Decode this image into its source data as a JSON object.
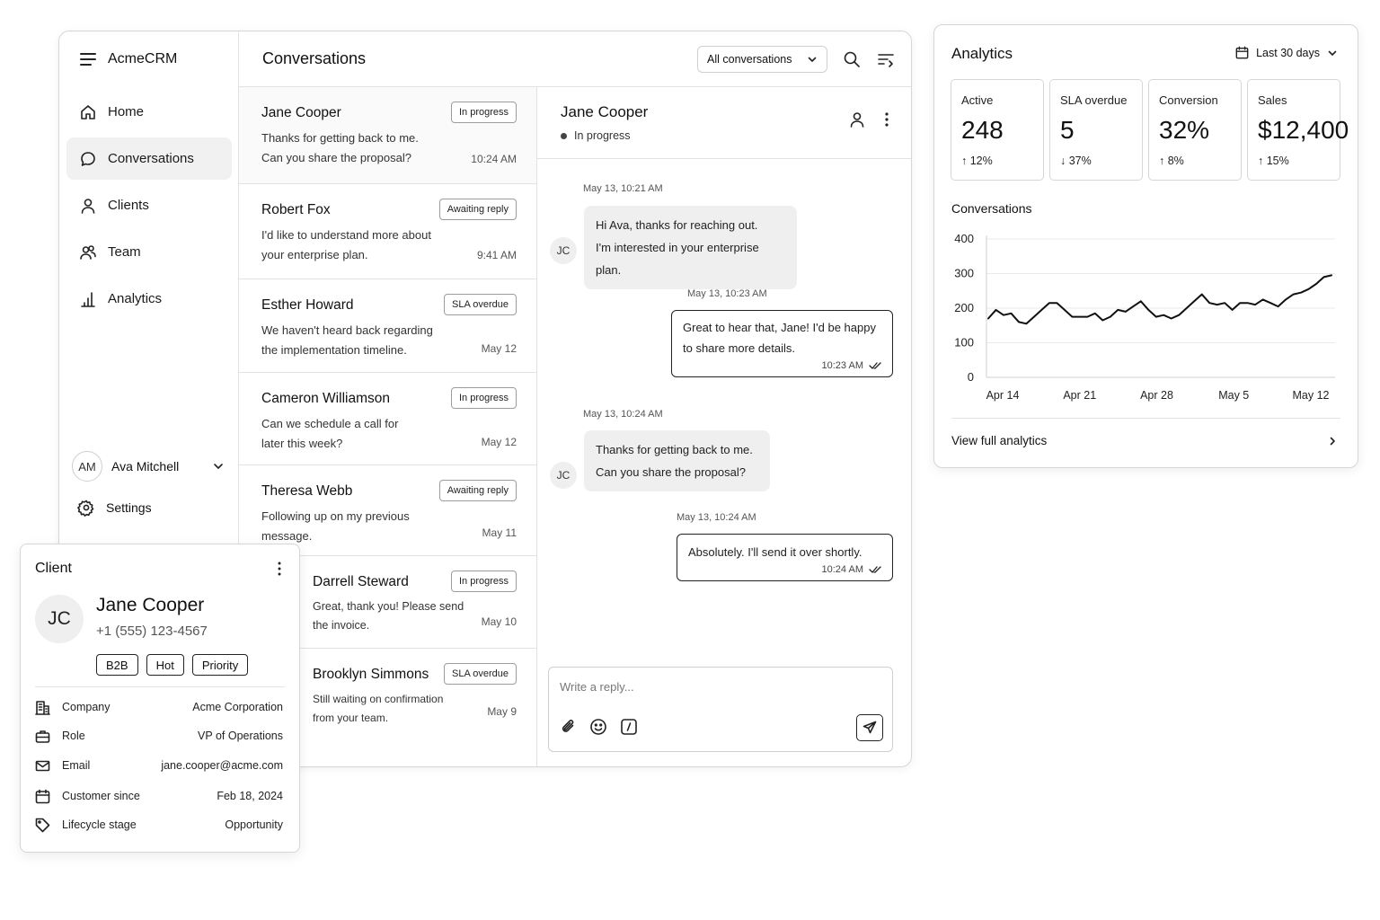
{
  "app": {
    "name": "AcmeCRM"
  },
  "sidebar": {
    "items": [
      {
        "label": "Home",
        "icon": "home-icon"
      },
      {
        "label": "Conversations",
        "icon": "chat-icon",
        "active": true
      },
      {
        "label": "Clients",
        "icon": "user-icon"
      },
      {
        "label": "Team",
        "icon": "team-icon"
      },
      {
        "label": "Analytics",
        "icon": "bar-chart-icon"
      }
    ],
    "user": {
      "initials": "AM",
      "name": "Ava Mitchell"
    },
    "settings_label": "Settings"
  },
  "conversations": {
    "title": "Conversations",
    "filter": "All conversations",
    "items": [
      {
        "name": "Jane Cooper",
        "status": "In progress",
        "preview_1": "Thanks for getting back to me.",
        "preview_2": "Can you share the proposal?",
        "time": "10:24 AM"
      },
      {
        "name": "Robert Fox",
        "status": "Awaiting reply",
        "preview_1": "I'd like to understand more about",
        "preview_2": "your enterprise plan.",
        "time": "9:41 AM"
      },
      {
        "name": "Esther Howard",
        "status": "SLA overdue",
        "preview_1": "We haven't heard back regarding",
        "preview_2": "the implementation timeline.",
        "time": "May 12"
      },
      {
        "name": "Cameron Williamson",
        "status": "In progress",
        "preview_1": "Can we schedule a call for",
        "preview_2": "later this week?",
        "time": "May 12"
      },
      {
        "name": "Theresa Webb",
        "status": "Awaiting reply",
        "preview_1": "Following up on my previous",
        "preview_2": "message.",
        "time": "May 11"
      },
      {
        "name": "Darrell Steward",
        "status": "In progress",
        "preview_1": "Great, thank you! Please send",
        "preview_2": "the invoice.",
        "time": "May 10"
      },
      {
        "name": "Brooklyn Simmons",
        "status": "SLA overdue",
        "preview_1": "Still waiting on confirmation",
        "preview_2": "from your team.",
        "time": "May 9"
      }
    ]
  },
  "chat": {
    "name": "Jane Cooper",
    "status": "In progress",
    "contact_initials": "JC",
    "messages": [
      {
        "timestamp": "May 13, 10:21 AM",
        "line_1": "Hi Ava, thanks for reaching out.",
        "line_2": "I'm interested in your enterprise plan."
      },
      {
        "timestamp": "May 13, 10:23 AM",
        "line_1": "Great to hear that, Jane! I'd be happy",
        "line_2": "to share more details.",
        "time": "10:23 AM"
      },
      {
        "timestamp": "May 13, 10:24 AM",
        "line_1": "Thanks for getting back to me.",
        "line_2": "Can you share the proposal?"
      },
      {
        "timestamp": "May 13, 10:24 AM",
        "line_1": "Absolutely. I'll send it over shortly.",
        "time": "10:24 AM"
      }
    ],
    "composer_placeholder": "Write a reply..."
  },
  "client": {
    "title": "Client",
    "initials": "JC",
    "name": "Jane Cooper",
    "phone": "+1 (555) 123-4567",
    "tags": [
      "B2B",
      "Hot",
      "Priority"
    ],
    "details": [
      {
        "label": "Company",
        "value": "Acme Corporation",
        "icon": "building-icon"
      },
      {
        "label": "Role",
        "value": "VP of Operations",
        "icon": "briefcase-icon"
      },
      {
        "label": "Email",
        "value": "jane.cooper@acme.com",
        "icon": "mail-icon"
      },
      {
        "label": "Customer since",
        "value": "Feb 18, 2024",
        "icon": "calendar-icon"
      },
      {
        "label": "Lifecycle stage",
        "value": "Opportunity",
        "icon": "tag-icon"
      }
    ]
  },
  "analytics": {
    "title": "Analytics",
    "range": "Last 30 days",
    "stats": [
      {
        "label": "Active",
        "value": "248",
        "change": "↑ 12%"
      },
      {
        "label": "SLA overdue",
        "value": "5",
        "change": "↓ 37%"
      },
      {
        "label": "Conversion",
        "value": "32%",
        "change": "↑ 8%"
      },
      {
        "label": "Sales",
        "value": "$12,400",
        "change": "↑ 15%"
      }
    ],
    "chart_title": "Conversations",
    "link": "View full analytics"
  },
  "chart_data": {
    "type": "line",
    "title": "Conversations",
    "x_ticks": [
      "Apr 14",
      "Apr 21",
      "Apr 28",
      "May 5",
      "May 12"
    ],
    "y_ticks": [
      0,
      100,
      200,
      300,
      400
    ],
    "ylim": [
      0,
      400
    ],
    "grid": true,
    "series": [
      {
        "values": [
          170,
          195,
          180,
          185,
          160,
          155,
          175,
          195,
          215,
          215,
          195,
          175,
          175,
          175,
          185,
          165,
          175,
          195,
          190,
          205,
          220,
          195,
          175,
          180,
          170,
          180,
          200,
          220,
          240,
          215,
          210,
          215,
          195,
          215,
          215,
          210,
          225,
          215,
          205,
          225,
          240,
          245,
          255,
          270,
          290,
          295
        ]
      }
    ]
  }
}
